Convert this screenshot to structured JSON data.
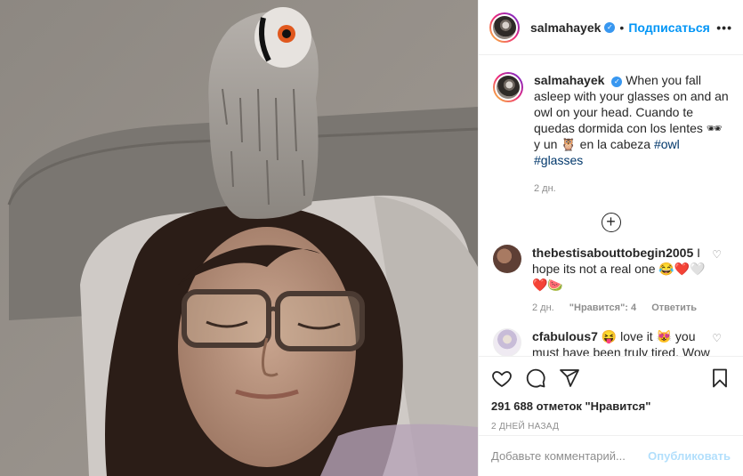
{
  "post": {
    "username": "salmahayek",
    "follow_label": "Подписаться",
    "more_label": "•••",
    "dot": "•"
  },
  "caption": {
    "username": "salmahayek",
    "text_1": "When you fall asleep with your glasses on and an owl on your head. Cuando te quedas dormida con los lentes ",
    "emoji_glasses": "🕶",
    "text_2": " y un ",
    "emoji_owl": "🦉",
    "text_3": " en la cabeza ",
    "hashtag_1": "#owl",
    "hashtag_2": "#glasses",
    "time": "2 дн."
  },
  "comments": [
    {
      "username": "thebestisabouttobegin2005",
      "text": "I hope its not a real one 😂❤️🤍❤️🍉",
      "time": "2 дн.",
      "likes": "\"Нравится\": 4",
      "reply": "Ответить"
    },
    {
      "username": "cfabulous7",
      "text": "😝 love it 😻 you must have been truly tired. Wow you have an owl 🦉 beautiful",
      "time": "",
      "likes": "",
      "reply": ""
    }
  ],
  "stats": {
    "likes": "291 688 отметок \"Нравится\"",
    "date": "2 ДНЕЙ НАЗАД"
  },
  "add_comment": {
    "placeholder": "Добавьте комментарий...",
    "publish_label": "Опубликовать"
  },
  "icons": {
    "like": "heart-icon",
    "comment": "comment-icon",
    "share": "share-icon",
    "save": "bookmark-icon",
    "load_more": "plus-circle-icon"
  },
  "colors": {
    "link": "#0095f6",
    "hashtag": "#00376b",
    "muted": "#8e8e8e",
    "publish_disabled": "#b2dffc"
  }
}
